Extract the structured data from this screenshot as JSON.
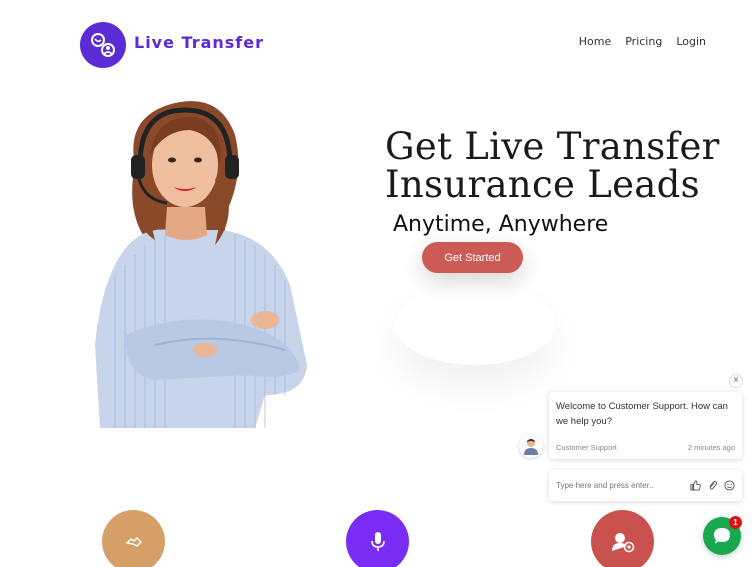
{
  "header": {
    "brand": "Live Transfer",
    "nav": [
      "Home",
      "Pricing",
      "Login"
    ]
  },
  "hero": {
    "headline_line1": "Get Live Transfer",
    "headline_line2": "Insurance Leads",
    "subheadline": "Anytime, Anywhere",
    "cta_label": "Get Started"
  },
  "features": [
    {
      "icon": "handshake-icon",
      "color": "#d4a067"
    },
    {
      "icon": "microphone-icon",
      "color": "#7a2cf5"
    },
    {
      "icon": "agent-badge-icon",
      "color": "#c9524f"
    }
  ],
  "chat": {
    "message": "Welcome to Customer Support. How can we help you?",
    "sender": "Customer Support",
    "time": "2 minutes ago",
    "input_placeholder": "Type here and press enter..",
    "unread_count": "1"
  },
  "colors": {
    "brand": "#5b2bd6",
    "cta": "#cc5a55",
    "chat_launcher": "#18a84f"
  }
}
